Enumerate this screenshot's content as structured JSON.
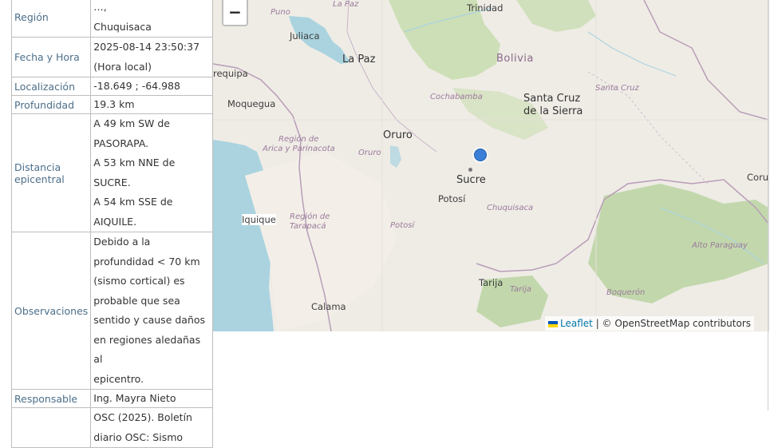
{
  "table": {
    "rows": [
      {
        "key": "Región",
        "value": [
          "…, ",
          "Chuquisaca"
        ]
      },
      {
        "key": "Fecha y Hora",
        "value": [
          "2025-08-14 23:50:37",
          "(Hora local)"
        ]
      },
      {
        "key": "Localización",
        "value": [
          "-18.649 ; -64.988"
        ]
      },
      {
        "key": "Profundidad",
        "value": [
          "19.3 km"
        ]
      },
      {
        "key": "Distancia epicentral",
        "value": [
          "A 49 km SW de",
          "PASORAPA.",
          "A 53 km NNE de SUCRE.",
          "A 54 km SSE de",
          "AIQUILE."
        ]
      },
      {
        "key": "Observaciones",
        "value": [
          "Debido a la",
          "profundidad < 70 km",
          "(sismo cortical) es",
          "probable que sea",
          "sentido y cause daños",
          "en regiones aledañas al",
          "epicentro."
        ]
      },
      {
        "key": "Responsable",
        "value": [
          "Ing. Mayra Nieto"
        ]
      },
      {
        "key": "",
        "value": [
          "OSC (2025). Boletín",
          "diario OSC: Sismo"
        ]
      }
    ]
  },
  "map": {
    "zoom_out_label": "−",
    "labels": {
      "puno": "Puno",
      "la_paz_top": "La Paz",
      "trinidad": "Trinidad",
      "juliaca": "Juliaca",
      "la_paz": "La Paz",
      "bolivia": "Bolivia",
      "arequipa": "requipa",
      "santa_cruz_region": "Santa Cruz",
      "moquegua": "Moquegua",
      "cochabamba": "Cochabamba",
      "santa_cruz_city_1": "Santa Cruz",
      "santa_cruz_city_2": "de la Sierra",
      "arica_region_1": "Región de",
      "arica_region_2": "Arica y Parinacota",
      "oruro_city": "Oruro",
      "oruro_region": "Oruro",
      "sucre": "Sucre",
      "potosi_city": "Potosí",
      "chuquisaca": "Chuquisaca",
      "corumba": "Coru",
      "iquique": "Iquique",
      "tarapaca_1": "Región de",
      "tarapaca_2": "Tarapacá",
      "potosi_region": "Potosí",
      "alto_paraguay": "Alto Paraguay",
      "tarija_city": "Tarija",
      "tarija_region": "Tarija",
      "boqueron": "Boquerón",
      "calama": "Calama"
    },
    "attribution": {
      "leaflet": "Leaflet",
      "sep": " | © ",
      "osm": "OpenStreetMap contributors"
    }
  },
  "colors": {
    "marker": "#3b7fd6",
    "water": "#aad3df",
    "forest": "#b7d39e",
    "land": "#efece6"
  }
}
